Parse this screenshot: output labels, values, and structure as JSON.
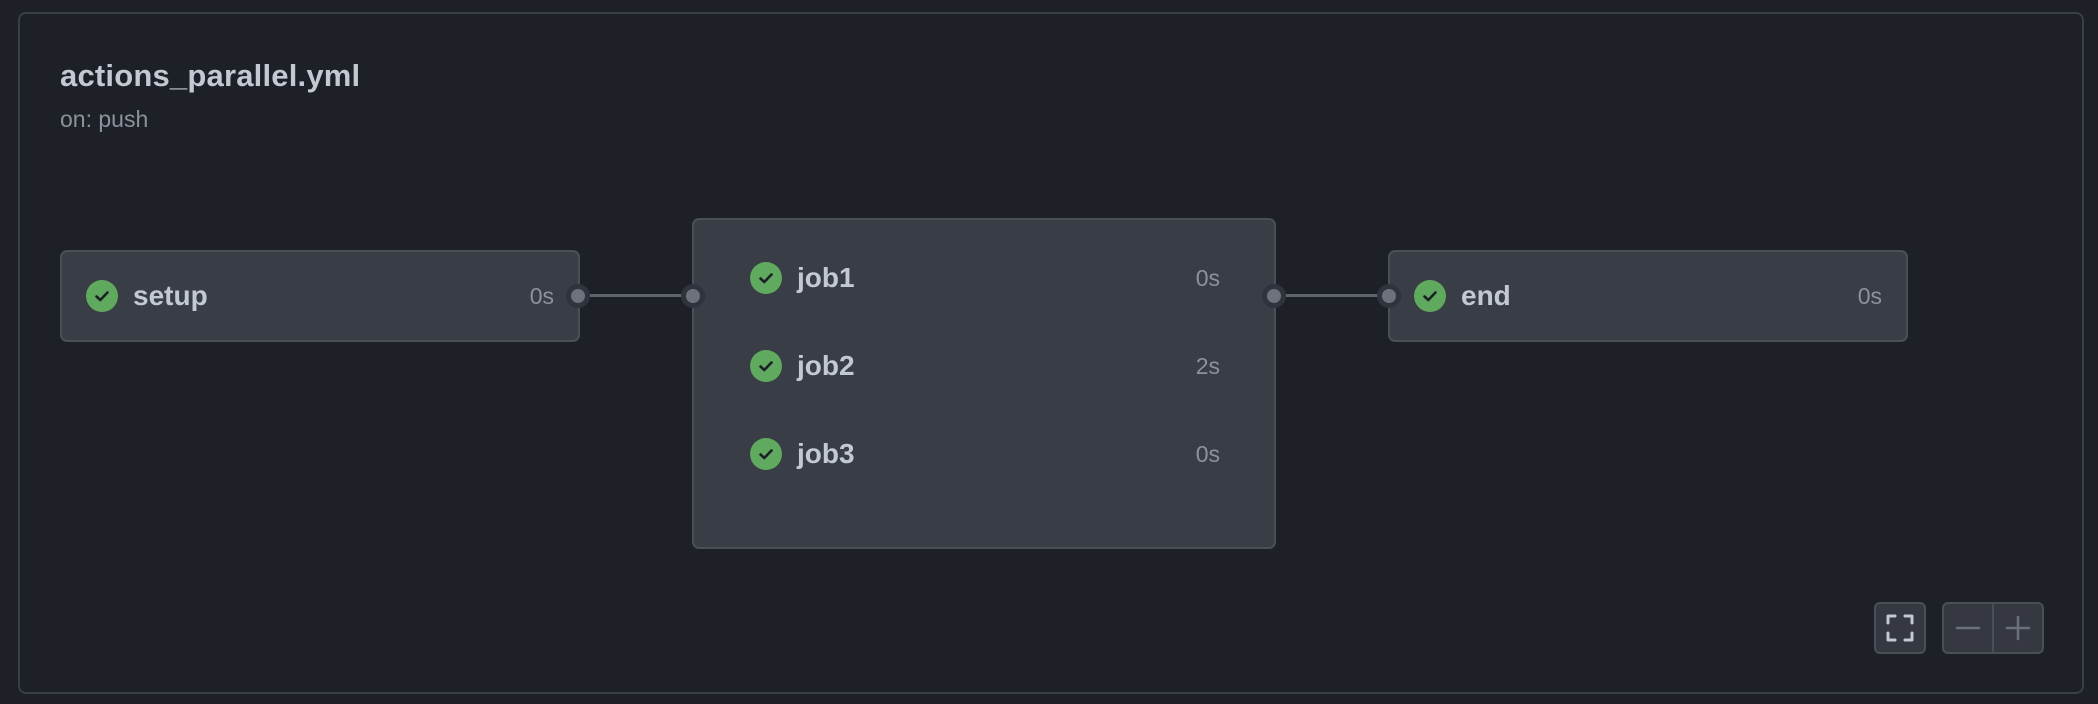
{
  "workflow": {
    "title": "actions_parallel.yml",
    "trigger": "on: push"
  },
  "jobs": {
    "setup": {
      "name": "setup",
      "duration": "0s",
      "status": "success"
    },
    "job1": {
      "name": "job1",
      "duration": "0s",
      "status": "success"
    },
    "job2": {
      "name": "job2",
      "duration": "2s",
      "status": "success"
    },
    "job3": {
      "name": "job3",
      "duration": "0s",
      "status": "success"
    },
    "end": {
      "name": "end",
      "duration": "0s",
      "status": "success"
    }
  },
  "controls": {
    "fullscreen_icon": "fullscreen-icon",
    "zoom_out_icon": "minus-icon",
    "zoom_in_icon": "plus-icon"
  },
  "colors": {
    "background": "#1e2028",
    "node": "#393d45",
    "success": "#5faa5f",
    "text": "#c3c9d2",
    "muted": "#8b929c"
  }
}
